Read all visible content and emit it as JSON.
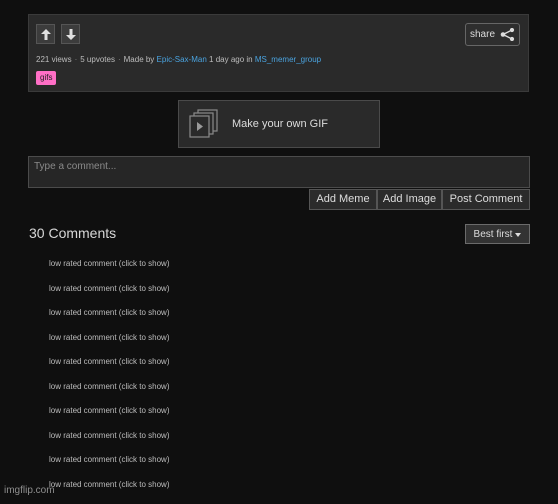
{
  "post": {
    "share_label": "share",
    "views": "221 views",
    "upvotes": "5 upvotes",
    "made_by_prefix": "Made by",
    "author": "Epic-Sax-Man",
    "time_in": "1 day ago in",
    "stream": "MS_memer_group",
    "tag": "gifs"
  },
  "make_gif": {
    "label": "Make your own GIF"
  },
  "comment_box": {
    "placeholder": "Type a comment...",
    "add_meme": "Add Meme",
    "add_image": "Add Image",
    "post_comment": "Post Comment"
  },
  "comments": {
    "count_label": "30 Comments",
    "sort_label": "Best first",
    "items": [
      "low rated comment (click to show)",
      "low rated comment (click to show)",
      "low rated comment (click to show)",
      "low rated comment (click to show)",
      "low rated comment (click to show)",
      "low rated comment (click to show)",
      "low rated comment (click to show)",
      "low rated comment (click to show)",
      "low rated comment (click to show)",
      "low rated comment (click to show)"
    ]
  },
  "watermark": "imgflip.com"
}
